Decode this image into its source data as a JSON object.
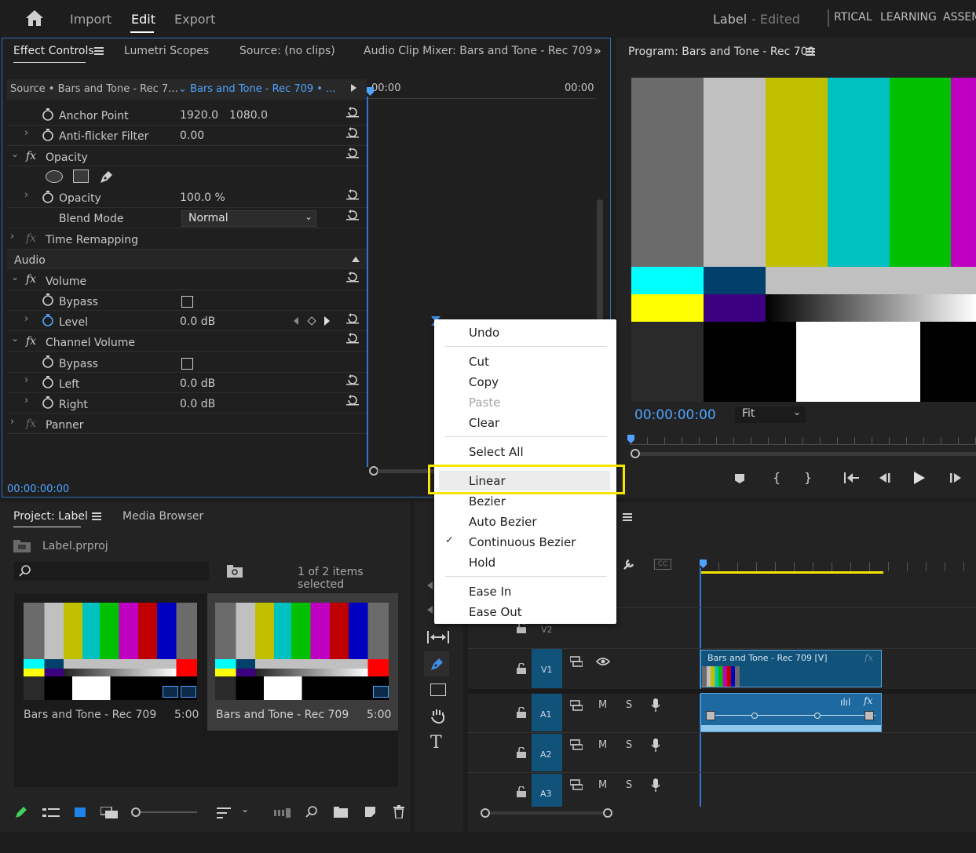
{
  "topbar": {
    "nav": [
      "Import",
      "Edit",
      "Export"
    ],
    "active": "Edit",
    "label": "Label",
    "edited": "- Edited",
    "workspaces": [
      "RTICAL",
      "LEARNING",
      "ASSEM"
    ]
  },
  "effect_panel": {
    "tabs": [
      "Effect Controls",
      "Lumetri Scopes",
      "Source: (no clips)",
      "Audio Clip Mixer: Bars and Tone - Rec 709"
    ],
    "source_label": "Source • Bars and Tone - Rec 7...",
    "sequence_label": "Bars and Tone - Rec 709 • ...",
    "timecode_left": "00:00",
    "timecode_right": "00:00",
    "rows": {
      "anchor_point": "Anchor Point",
      "anchor_x": "1920.0",
      "anchor_y": "1080.0",
      "anti_flicker": "Anti-flicker Filter",
      "anti_flicker_val": "0.00",
      "opacity_group": "Opacity",
      "opacity": "Opacity",
      "opacity_val": "100.0 %",
      "blend_mode": "Blend Mode",
      "blend_val": "Normal",
      "time_remap": "Time Remapping",
      "audio_section": "Audio",
      "volume": "Volume",
      "bypass": "Bypass",
      "level": "Level",
      "level_val": "0.0 dB",
      "channel_volume": "Channel Volume",
      "bypass2": "Bypass",
      "left": "Left",
      "left_val": "0.0 dB",
      "right": "Right",
      "right_val": "0.0 dB",
      "panner": "Panner"
    },
    "footer_timecode": "00:00:00:00"
  },
  "program_monitor": {
    "title": "Program: Bars and Tone - Rec 709",
    "timecode": "00:00:00:00",
    "zoom": "Fit"
  },
  "project_panel": {
    "tabs": [
      "Project: Label",
      "Media Browser"
    ],
    "project_file": "Label.prproj",
    "selection_info": "1 of 2 items selected",
    "items": [
      {
        "name": "Bars and Tone - Rec 709",
        "duration": "5:00"
      },
      {
        "name": "Bars and Tone - Rec 709",
        "duration": "5:00"
      }
    ]
  },
  "timeline": {
    "tracks": [
      "V2",
      "V1",
      "A1",
      "A2",
      "A3"
    ],
    "clip_video": "Bars and Tone - Rec 709 [V]",
    "mute": "M",
    "solo": "S"
  },
  "context_menu": {
    "items": [
      "Undo",
      "Cut",
      "Copy",
      "Paste",
      "Clear",
      "Select All",
      "Linear",
      "Bezier",
      "Auto Bezier",
      "Continuous Bezier",
      "Hold",
      "Ease In",
      "Ease Out"
    ],
    "disabled": [
      "Paste"
    ],
    "checked": "Continuous Bezier",
    "highlighted": "Linear"
  },
  "colors": {
    "accent_blue": "#4fa3ff",
    "highlight_yellow": "#f5e400",
    "track_blue": "#10527a"
  }
}
